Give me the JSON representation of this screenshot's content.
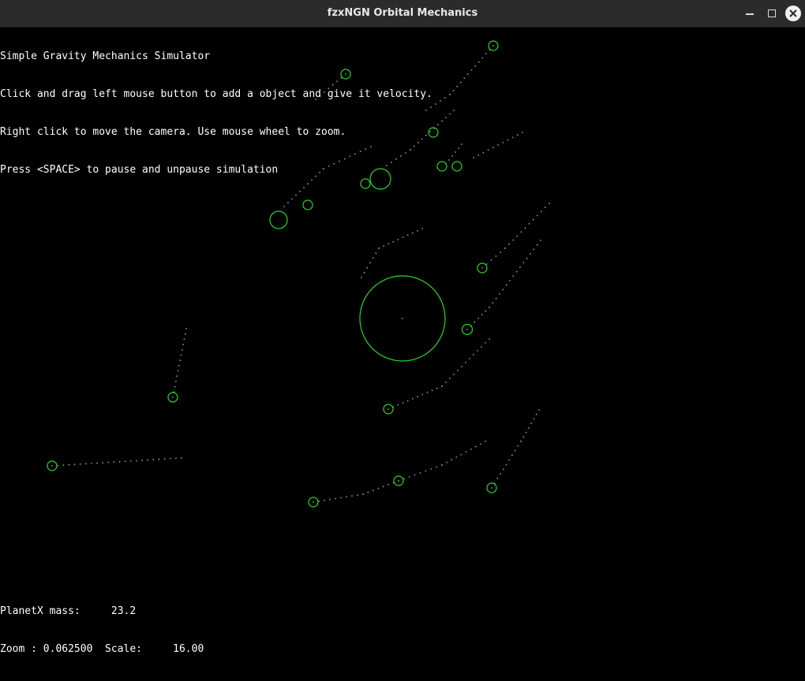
{
  "window": {
    "title": "fzxNGN Orbital Mechanics",
    "controls": [
      "minimize-icon",
      "maximize-icon",
      "close-icon"
    ]
  },
  "hud": {
    "top_lines": [
      "Simple Gravity Mechanics Simulator",
      "Click and drag left mouse button to add a object and give it velocity.",
      "Right click to move the camera. Use mouse wheel to zoom.",
      "Press <SPACE> to pause and unpause simulation"
    ],
    "bottom_lines": [
      "PlanetX mass:     23.2",
      "Zoom : 0.062500  Scale:     16.00"
    ]
  },
  "colors": {
    "background": "#000000",
    "object_outline": "#28d828",
    "trail": "#9a9a9a",
    "text": "#ffffff",
    "titlebar": "#2b2b2b"
  }
}
